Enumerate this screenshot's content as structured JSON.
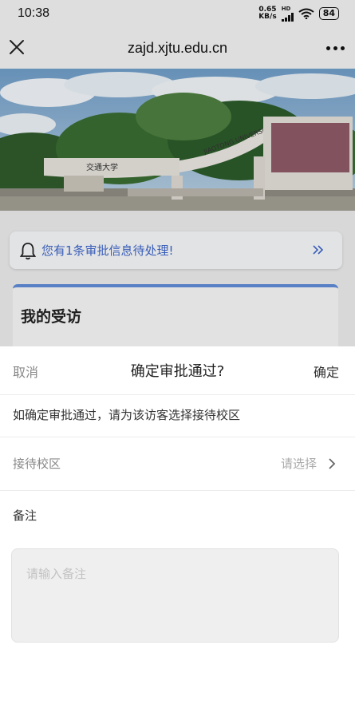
{
  "status_bar": {
    "time": "10:38",
    "net_speed_value": "0.65",
    "net_speed_unit": "KB/s",
    "hd_badge": "HD",
    "battery": "84"
  },
  "nav": {
    "title": "zajd.xjtu.edu.cn",
    "close_icon": "close-icon",
    "more_icon": "more-icon"
  },
  "banner": {
    "gate_sign": "交通大学",
    "arch_text": "JIAOTONG UNIVERSITY"
  },
  "notice": {
    "text": "您有1条审批信息待处理!",
    "icon": "bell-icon",
    "accent_color": "#3e66c6"
  },
  "card": {
    "title": "我的受访",
    "accent_color": "#5f8ad6"
  },
  "dialog": {
    "cancel_label": "取消",
    "title": "确定审批通过?",
    "confirm_label": "确定",
    "hint": "如确定审批通过，请为该访客选择接待校区",
    "campus_label": "接待校区",
    "campus_value": "请选择",
    "note_label": "备注",
    "note_placeholder": "请输入备注"
  }
}
